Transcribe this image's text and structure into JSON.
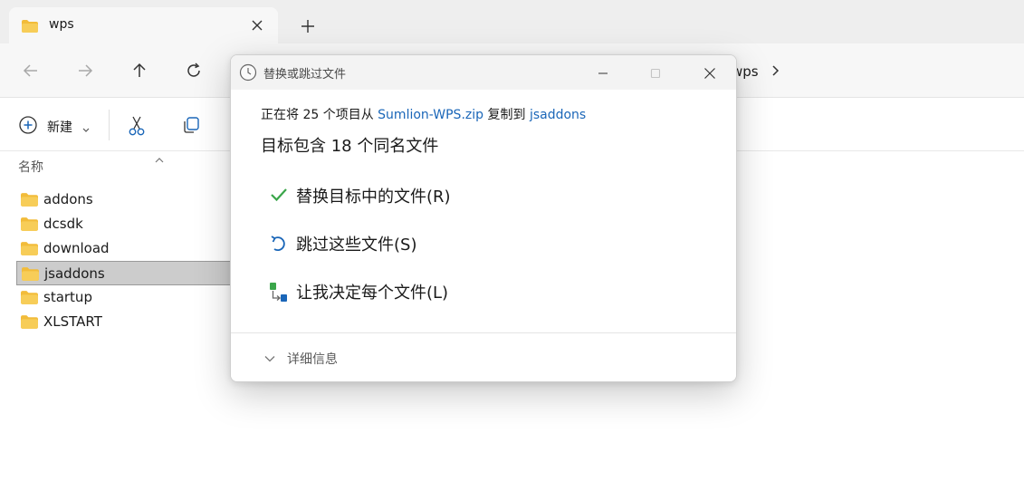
{
  "tab": {
    "title": "wps"
  },
  "breadcrumb": {
    "current": "wps"
  },
  "commandbar": {
    "new_label": "新建"
  },
  "columns": {
    "name": "名称"
  },
  "files": [
    {
      "name": "addons",
      "selected": false
    },
    {
      "name": "dcsdk",
      "selected": false
    },
    {
      "name": "download",
      "selected": false
    },
    {
      "name": "jsaddons",
      "selected": true
    },
    {
      "name": "startup",
      "selected": false
    },
    {
      "name": "XLSTART",
      "selected": false
    }
  ],
  "dialog": {
    "title": "替换或跳过文件",
    "copy": {
      "prefix": "正在将 25 个项目从 ",
      "source": "Sumlion-WPS.zip",
      "middle": " 复制到 ",
      "dest": "jsaddons"
    },
    "conflict": "目标包含 18 个同名文件",
    "options": {
      "replace": "替换目标中的文件(R)",
      "skip": "跳过这些文件(S)",
      "decide": "让我决定每个文件(L)"
    },
    "details": "详细信息"
  },
  "colors": {
    "accent": "#1a66b8",
    "check": "#3aa64a",
    "folder": "#f2bc3a",
    "selection": "#cccccc"
  }
}
